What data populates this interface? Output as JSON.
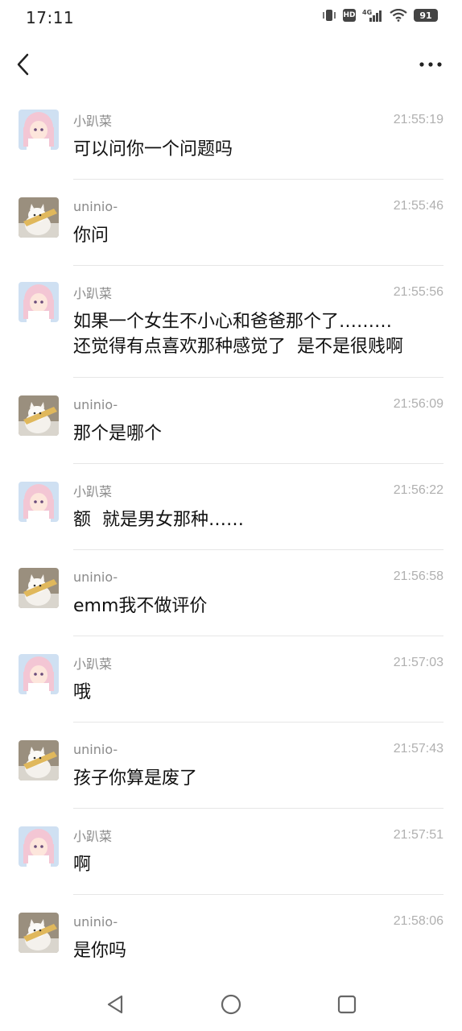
{
  "status_bar": {
    "time": "17:11",
    "network": "4G",
    "hd": "HD",
    "battery": "91"
  },
  "messages": [
    {
      "sender": "小趴菜",
      "time": "21:55:19",
      "text": "可以问你一个问题吗",
      "avatar": "anime-girl"
    },
    {
      "sender": "uninio-",
      "time": "21:55:46",
      "text": "你问",
      "avatar": "cat"
    },
    {
      "sender": "小趴菜",
      "time": "21:55:56",
      "text": "如果一个女生不小心和爸爸那个了………\n还觉得有点喜欢那种感觉了  是不是很贱啊",
      "avatar": "anime-girl"
    },
    {
      "sender": "uninio-",
      "time": "21:56:09",
      "text": "那个是哪个",
      "avatar": "cat"
    },
    {
      "sender": "小趴菜",
      "time": "21:56:22",
      "text": "额  就是男女那种……",
      "avatar": "anime-girl"
    },
    {
      "sender": "uninio-",
      "time": "21:56:58",
      "text": "emm我不做评价",
      "avatar": "cat"
    },
    {
      "sender": "小趴菜",
      "time": "21:57:03",
      "text": "哦",
      "avatar": "anime-girl"
    },
    {
      "sender": "uninio-",
      "time": "21:57:43",
      "text": "孩子你算是废了",
      "avatar": "cat"
    },
    {
      "sender": "小趴菜",
      "time": "21:57:51",
      "text": "啊",
      "avatar": "anime-girl"
    },
    {
      "sender": "uninio-",
      "time": "21:58:06",
      "text": "是你吗",
      "avatar": "cat"
    }
  ],
  "icons": {
    "back": "back-icon",
    "more": "more-icon",
    "nav_back": "nav-back-icon",
    "nav_home": "nav-home-icon",
    "nav_recent": "nav-recent-icon"
  }
}
